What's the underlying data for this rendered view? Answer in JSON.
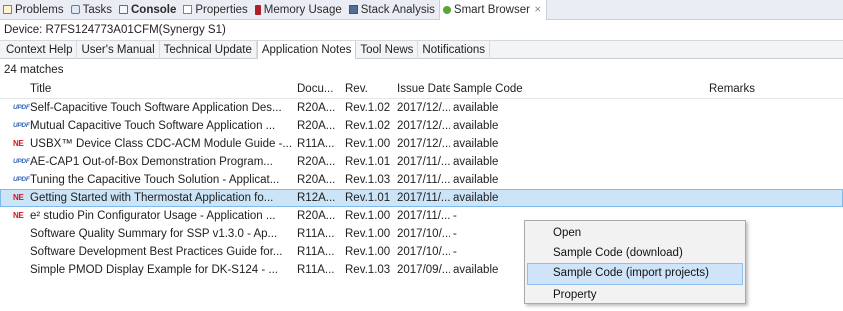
{
  "view_tabs": [
    {
      "label": "Problems",
      "icon": "problems-icon"
    },
    {
      "label": "Tasks",
      "icon": "tasks-icon"
    },
    {
      "label": "Console",
      "icon": "console-icon",
      "bold": true
    },
    {
      "label": "Properties",
      "icon": "properties-icon"
    },
    {
      "label": "Memory Usage",
      "icon": "memory-usage-icon"
    },
    {
      "label": "Stack Analysis",
      "icon": "stack-analysis-icon"
    },
    {
      "label": "Smart Browser",
      "icon": "smart-browser-icon",
      "close": "⨯"
    }
  ],
  "device_label": "Device: R7FS124773A01CFM(Synergy S1)",
  "doc_tabs": [
    "Context Help",
    "User's Manual",
    "Technical Update",
    "Application Notes",
    "Tool News",
    "Notifications"
  ],
  "active_doc_tab": "Application Notes",
  "matches": "24 matches",
  "columns": {
    "title": "Title",
    "doc": "Docu...",
    "rev": "Rev.",
    "issue_date": "Issue Date",
    "sample_code": "Sample Code",
    "remarks": "Remarks"
  },
  "rows": [
    {
      "logo": "updf",
      "title": "Self-Capacitive Touch Software Application Des...",
      "doc": "R20A...",
      "rev": "Rev.1.02",
      "date": "2017/12/...",
      "code": "available"
    },
    {
      "logo": "updf",
      "title": "Mutual Capacitive Touch Software Application ...",
      "doc": "R20A...",
      "rev": "Rev.1.02",
      "date": "2017/12/...",
      "code": "available"
    },
    {
      "logo": "ne",
      "title": "USBX™ Device Class CDC-ACM Module Guide -...",
      "doc": "R11A...",
      "rev": "Rev.1.00",
      "date": "2017/12/...",
      "code": "available"
    },
    {
      "logo": "updf",
      "title": "AE-CAP1 Out-of-Box Demonstration Program...",
      "doc": "R20A...",
      "rev": "Rev.1.01",
      "date": "2017/11/...",
      "code": "available"
    },
    {
      "logo": "updf",
      "title": "Tuning the Capacitive Touch Solution - Applicat...",
      "doc": "R20A...",
      "rev": "Rev.1.03",
      "date": "2017/11/...",
      "code": "available"
    },
    {
      "logo": "ne",
      "title": "Getting Started with Thermostat Application fo...",
      "doc": "R12A...",
      "rev": "Rev.1.01",
      "date": "2017/11/...",
      "code": "available",
      "selected": true
    },
    {
      "logo": "ne",
      "title": "e² studio Pin Configurator Usage - Application ...",
      "doc": "R20A...",
      "rev": "Rev.1.00",
      "date": "2017/11/...",
      "code": "-"
    },
    {
      "logo": "none",
      "title": "Software Quality Summary for SSP v1.3.0 - Ap...",
      "doc": "R11A...",
      "rev": "Rev.1.00",
      "date": "2017/10/...",
      "code": "-"
    },
    {
      "logo": "none",
      "title": "Software Development Best Practices Guide for...",
      "doc": "R11A...",
      "rev": "Rev.1.00",
      "date": "2017/10/...",
      "code": "-"
    },
    {
      "logo": "none",
      "title": "Simple PMOD Display Example for DK-S124 - ...",
      "doc": "R11A...",
      "rev": "Rev.1.03",
      "date": "2017/09/...",
      "code": "available"
    }
  ],
  "logos": {
    "updf": "UPDF",
    "ne": "NE"
  },
  "context_menu": {
    "items": [
      "Open",
      "Sample Code (download)",
      "Sample Code (import projects)",
      "Property"
    ],
    "highlighted_index": 2
  }
}
